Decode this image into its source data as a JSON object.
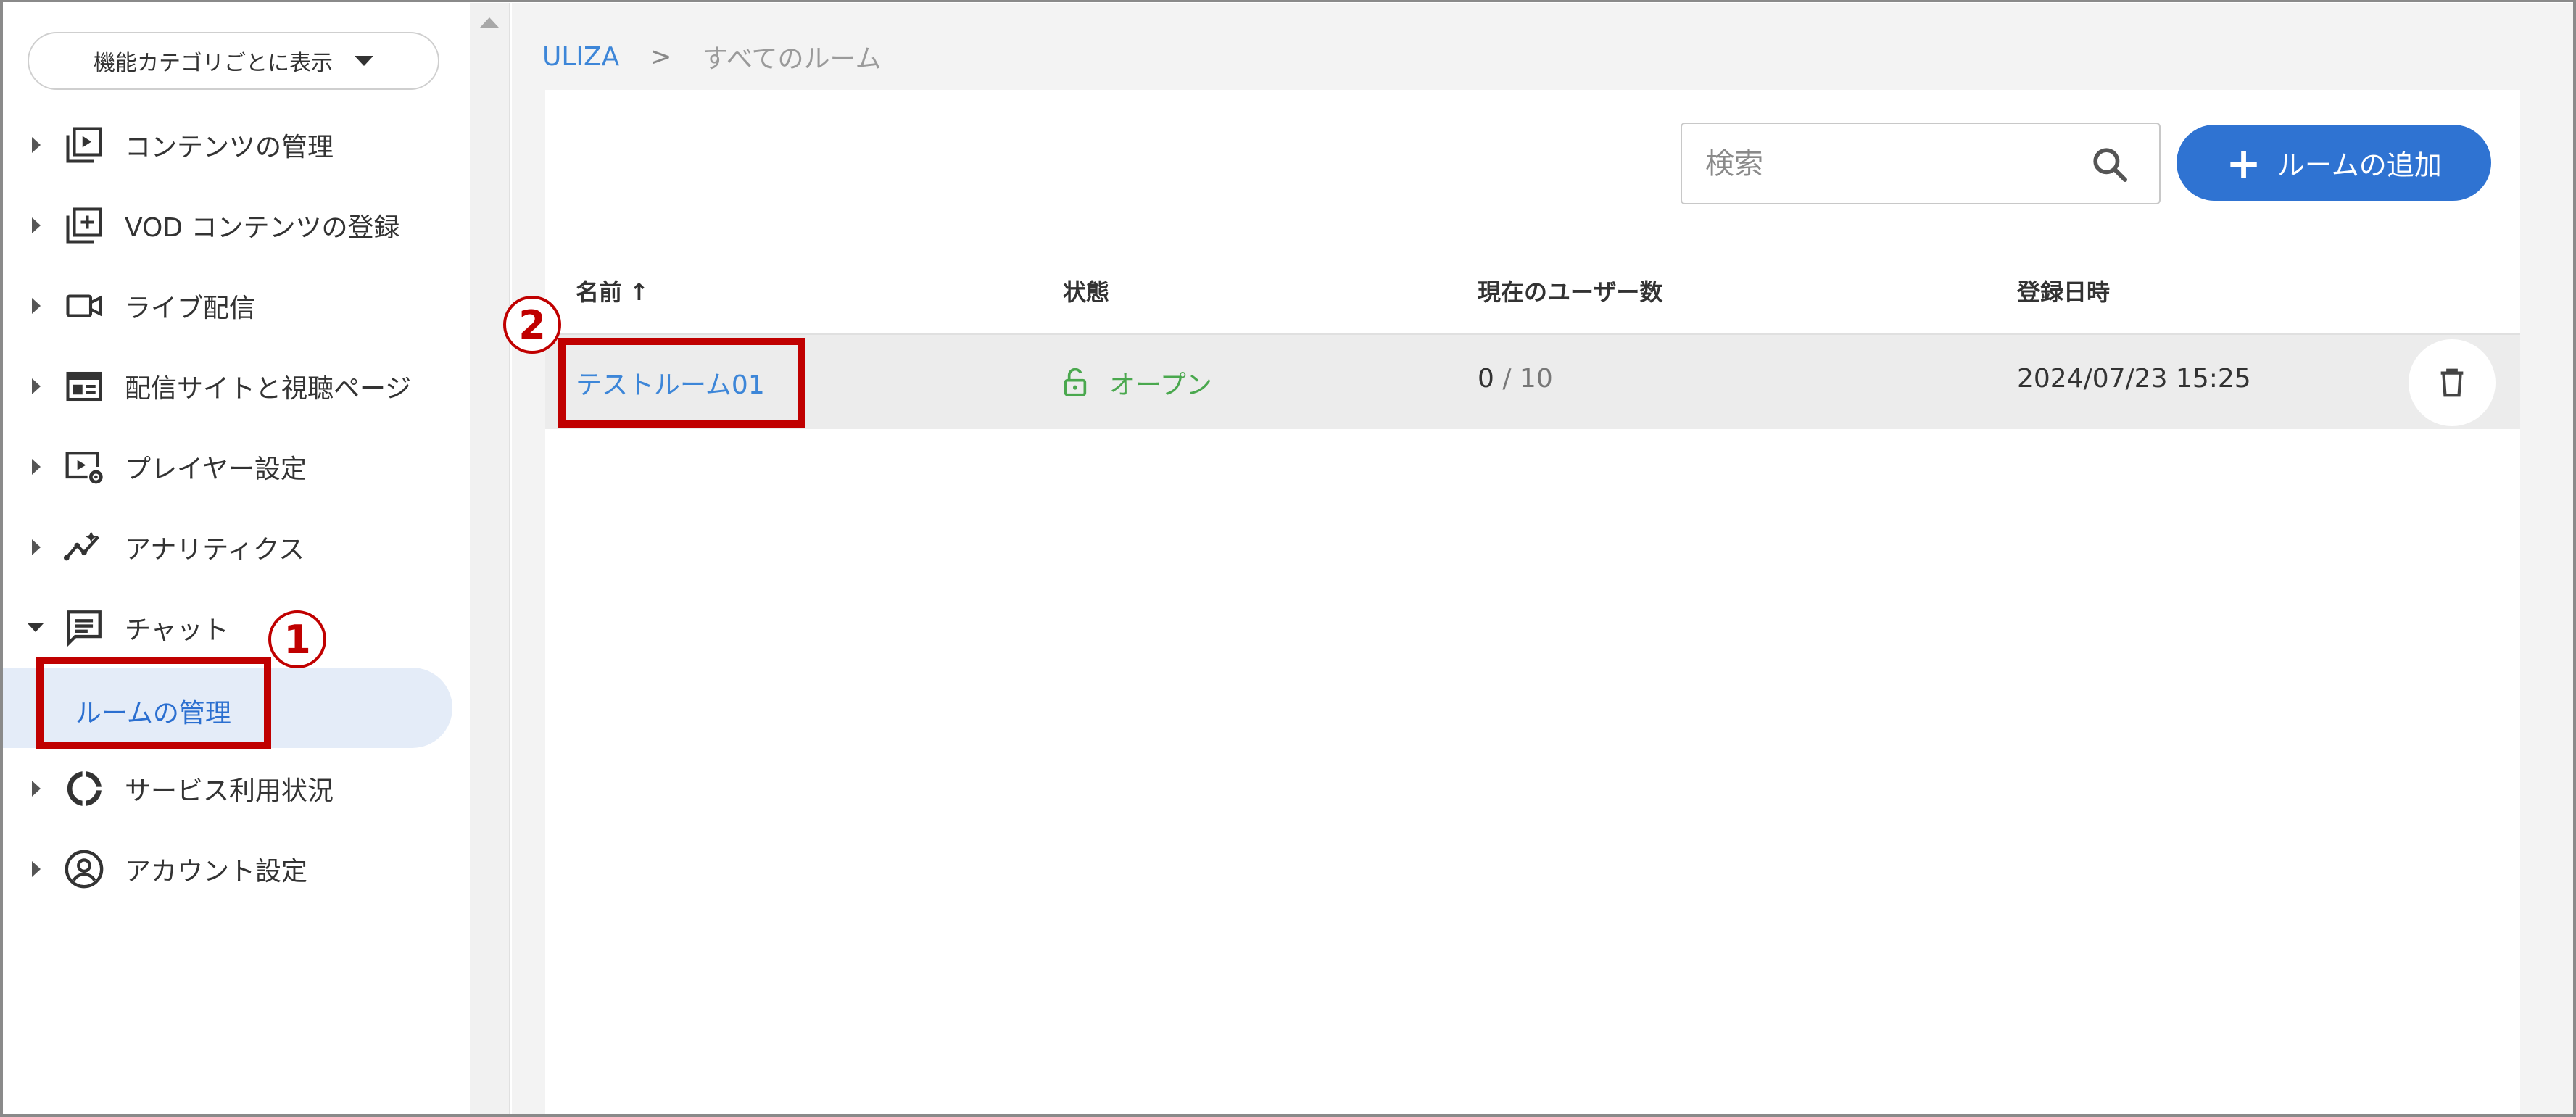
{
  "sidebar": {
    "category_select": "機能カテゴリごとに表示",
    "items": [
      {
        "label": "コンテンツの管理",
        "icon": "play-box-icon"
      },
      {
        "label": "VOD コンテンツの登録",
        "icon": "add-box-icon"
      },
      {
        "label": "ライブ配信",
        "icon": "video-camera-icon"
      },
      {
        "label": "配信サイトと視聴ページ",
        "icon": "web-page-icon"
      },
      {
        "label": "プレイヤー設定",
        "icon": "player-settings-icon"
      },
      {
        "label": "アナリティクス",
        "icon": "analytics-icon"
      },
      {
        "label": "チャット",
        "icon": "chat-icon",
        "expanded": true
      },
      {
        "label": "サービス利用状況",
        "icon": "donut-chart-icon"
      },
      {
        "label": "アカウント設定",
        "icon": "account-circle-icon"
      }
    ],
    "sub_items": [
      {
        "label": "ルームの管理",
        "active": true
      }
    ]
  },
  "breadcrumb": {
    "root": "ULIZA",
    "separator": ">",
    "current": "すべてのルーム"
  },
  "toolbar": {
    "search_placeholder": "検索",
    "add_button": "ルームの追加",
    "add_plus": "+"
  },
  "table": {
    "headers": {
      "name": "名前",
      "sort_arrow": "↑",
      "status": "状態",
      "users": "現在のユーザー数",
      "registered": "登録日時"
    },
    "rows": [
      {
        "name": "テストルーム01",
        "status": "オープン",
        "users_current": "0",
        "users_max": " / 10",
        "registered": "2024/07/23 15:25"
      }
    ]
  },
  "annotations": {
    "marker1": "1",
    "marker2": "2"
  },
  "colors": {
    "accent": "#2f73d2",
    "link": "#3d86d8",
    "status_open": "#4aa84e",
    "highlight": "#c00000",
    "active_nav_bg": "#e4ecf8"
  }
}
